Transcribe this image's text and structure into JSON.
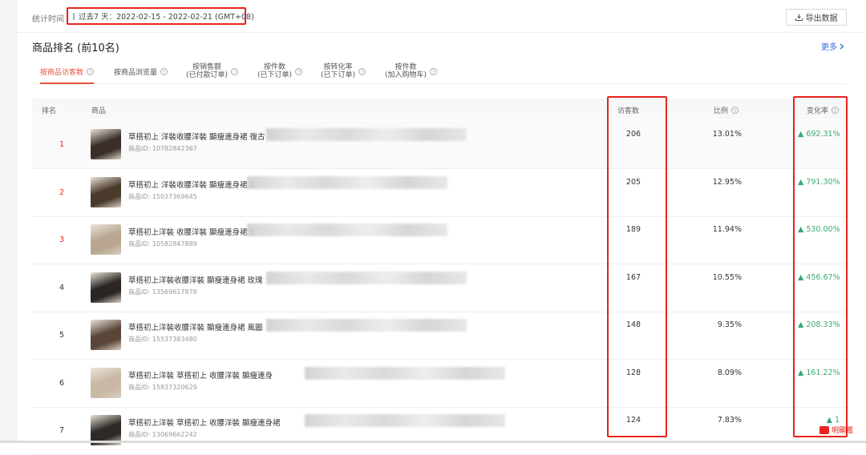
{
  "header": {
    "stat_label": "统计时间",
    "date_range": "过去7 天：2022-02-15 - 2022-02-21 (GMT+08)",
    "export_label": "导出数据"
  },
  "section": {
    "title": "商品排名 (前10名)",
    "more_label": "更多"
  },
  "tabs": [
    {
      "line1": "按商品访客数",
      "line2": "",
      "active": true
    },
    {
      "line1": "按商品浏览量",
      "line2": "",
      "active": false
    },
    {
      "line1": "按销售额",
      "line2": "(已付款订单)",
      "active": false
    },
    {
      "line1": "按件数",
      "line2": "(已下订单)",
      "active": false
    },
    {
      "line1": "按转化率",
      "line2": "(已下订单)",
      "active": false
    },
    {
      "line1": "按件数",
      "line2": "(加入购物车)",
      "active": false
    }
  ],
  "table": {
    "headers": {
      "rank": "排名",
      "product": "商品",
      "visits": "访客数",
      "ratio": "比例",
      "change": "变化率"
    },
    "id_prefix": "商品ID: ",
    "rows": [
      {
        "rank": "1",
        "name": "草搭初上 洋裝收腰洋裝 顯瘦連身裙 復古",
        "id": "10782842367",
        "visits": "206",
        "ratio": "13.01%",
        "change": "▲ 692.31%",
        "thumb_color": "#3a2e2a"
      },
      {
        "rank": "2",
        "name": "草搭初上 洋裝收腰洋裝 顯瘦連身裙 2",
        "id": "15037369645",
        "visits": "205",
        "ratio": "12.95%",
        "change": "▲ 791.30%",
        "thumb_color": "#4a3a2c"
      },
      {
        "rank": "3",
        "name": "草搭初上洋裝 收腰洋裝 顯瘦連身裙 S",
        "id": "10582847889",
        "visits": "189",
        "ratio": "11.94%",
        "change": "▲ 530.00%",
        "thumb_color": "#b8a690"
      },
      {
        "rank": "4",
        "name": "草搭初上洋裝收腰洋裝 顯瘦連身裙 玫瑰",
        "id": "13569617878",
        "visits": "167",
        "ratio": "10.55%",
        "change": "▲ 456.67%",
        "thumb_color": "#2b2624"
      },
      {
        "rank": "5",
        "name": "草搭初上洋裝收腰洋裝 顯瘦連身裙 風圖",
        "id": "15537383480",
        "visits": "148",
        "ratio": "9.35%",
        "change": "▲ 208.33%",
        "thumb_color": "#5a4638"
      },
      {
        "rank": "6",
        "name": "草搭初上洋裝 草搭初上 收腰洋裝 顯瘦連身",
        "id": "15837320629",
        "visits": "128",
        "ratio": "8.09%",
        "change": "▲ 161.22%",
        "thumb_color": "#c9b8a4"
      },
      {
        "rank": "7",
        "name": "草搭初上洋裝 草搭初上 收腰洋裝 顯瘦連身裙",
        "id": "13069662242",
        "visits": "124",
        "ratio": "7.83%",
        "change": "▲ 1",
        "thumb_color": "#2e2a28"
      }
    ]
  },
  "watermark": "明顯鑑",
  "colors": {
    "accent": "#e8533a",
    "highlight": "#e8231d",
    "positive": "#3aa874",
    "link": "#2f6fd6"
  }
}
